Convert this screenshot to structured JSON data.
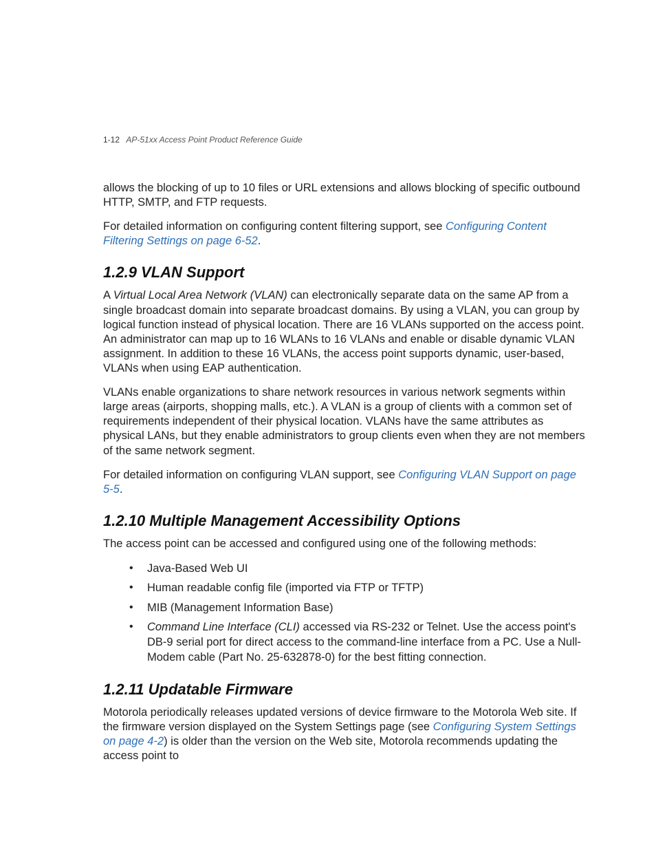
{
  "header": {
    "page_number": "1-12",
    "doc_title": "AP-51xx Access Point Product Reference Guide"
  },
  "intro": {
    "p1": "allows the blocking of up to 10 files or URL extensions and allows blocking of specific outbound HTTP, SMTP, and FTP requests.",
    "p2_lead": "For detailed information on configuring content filtering support, see ",
    "p2_link": "Configuring Content Filtering Settings on page 6-52",
    "p2_tail": "."
  },
  "s129": {
    "heading": "1.2.9 VLAN Support",
    "p1_lead": "A ",
    "p1_term": "Virtual Local Area Network (VLAN)",
    "p1_rest": " can electronically separate data on the same AP from a single broadcast domain into separate broadcast domains. By using a VLAN, you can group by logical function instead of physical location. There are 16 VLANs supported on the access point. An administrator can map up to 16 WLANs to 16 VLANs and enable or disable dynamic VLAN assignment. In addition to these 16 VLANs, the access point supports dynamic, user-based, VLANs when using EAP authentication.",
    "p2": "VLANs enable organizations to share network resources in various network segments within large areas (airports, shopping malls, etc.). A VLAN is a group of clients with a common set of requirements independent of their physical location. VLANs have the same attributes as physical LANs, but they enable administrators to group clients even when they are not members of the same network segment.",
    "p3_lead": "For detailed information on configuring VLAN support, see ",
    "p3_link": "Configuring VLAN Support on page 5-5",
    "p3_tail": "."
  },
  "s1210": {
    "heading": "1.2.10 Multiple Management Accessibility Options",
    "p1": "The access point can be accessed and configured using one of the following methods:",
    "items": {
      "i1": "Java-Based Web UI",
      "i2": "Human readable config file (imported via FTP or TFTP)",
      "i3": "MIB (Management Information Base)",
      "i4_term": "Command Line Interface (CLI)",
      "i4_rest": " accessed via RS-232 or Telnet. Use the access point's DB-9 serial port for direct access to the command-line interface from a PC. Use a Null-Modem cable (Part No. 25-632878-0) for the best fitting connection."
    }
  },
  "s1211": {
    "heading": "1.2.11 Updatable Firmware",
    "p1_lead": "Motorola periodically releases updated versions of device firmware to the Motorola Web site. If the firmware version displayed on the System Settings page (see ",
    "p1_link": "Configuring System Settings on page 4-2",
    "p1_tail": ") is older than the version on the Web site, Motorola recommends updating the access point to"
  }
}
